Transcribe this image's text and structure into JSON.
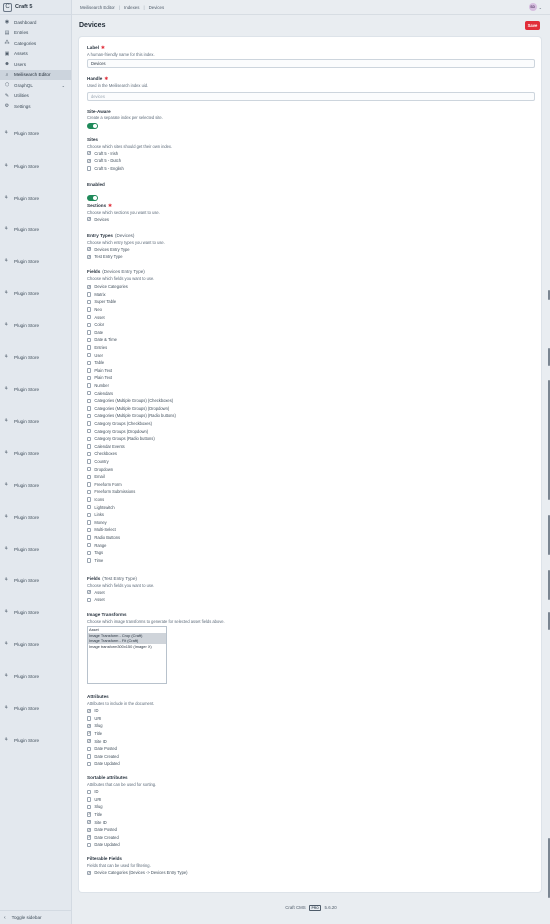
{
  "app": {
    "name": "Craft 5",
    "logo_letter": "C"
  },
  "nav": [
    {
      "label": "Dashboard",
      "icon": "gauge-icon",
      "glyph": "◉"
    },
    {
      "label": "Entries",
      "icon": "entries-icon",
      "glyph": "▤"
    },
    {
      "label": "Categories",
      "icon": "categories-icon",
      "glyph": "⁂"
    },
    {
      "label": "Assets",
      "icon": "image-icon",
      "glyph": "▣"
    },
    {
      "label": "Users",
      "icon": "users-icon",
      "glyph": "☻"
    },
    {
      "label": "Meilisearch Editor",
      "icon": "search-icon",
      "glyph": "⌕",
      "active": true
    },
    {
      "label": "GraphQL",
      "icon": "graphql-icon",
      "glyph": "⬡",
      "chevron": "⌄"
    },
    {
      "label": "Utilities",
      "icon": "wrench-icon",
      "glyph": "✎"
    },
    {
      "label": "Settings",
      "icon": "gear-icon",
      "glyph": "⚙"
    }
  ],
  "plugin_store_label": "Plugin Store",
  "toggle_sidebar_label": "Toggle sidebar",
  "breadcrumbs": [
    "Meilisearch Editor",
    "Indexes",
    "Devices"
  ],
  "user": {
    "initials": "SD",
    "chevron": "⌄"
  },
  "page": {
    "title": "Devices",
    "save_label": "Save"
  },
  "fields": {
    "label": {
      "label": "Label",
      "instructions": "A human-friendly name for this index.",
      "value": "Devices"
    },
    "handle": {
      "label": "Handle",
      "instructions": "Used in the Meilisearch index uid.",
      "value": "devices"
    },
    "site_aware": {
      "label": "Site-Aware",
      "instructions": "Create a separate index per selected site.",
      "on": true
    },
    "sites": {
      "label": "Sites",
      "instructions": "Choose which sites should get their own index.",
      "options": [
        {
          "label": "Craft 5 - Irish",
          "checked": true
        },
        {
          "label": "Craft 5 - Dutch",
          "checked": true
        },
        {
          "label": "Craft 5 - English",
          "checked": false
        }
      ]
    },
    "enabled": {
      "label": "Enabled",
      "on": true
    },
    "sections": {
      "label": "Sections",
      "instructions": "Choose which sections you want to use.",
      "options": [
        {
          "label": "Devices",
          "checked": true
        }
      ]
    },
    "entry_types": {
      "label": "Entry Types",
      "sub": "(Devices)",
      "instructions": "Choose which entry types you want to use.",
      "options": [
        {
          "label": "Devices Entry Type",
          "checked": true
        },
        {
          "label": "Test Entry Type",
          "checked": true
        }
      ]
    },
    "fields_devices": {
      "label": "Fields",
      "sub": "(Devices Entry Type)",
      "instructions": "Choose which fields you want to use.",
      "options": [
        {
          "label": "Device Categories",
          "checked": true
        },
        {
          "label": "Matrix",
          "checked": false
        },
        {
          "label": "Super Table",
          "checked": false
        },
        {
          "label": "Neo",
          "checked": false
        },
        {
          "label": "Asset",
          "checked": false
        },
        {
          "label": "Color",
          "checked": false
        },
        {
          "label": "Date",
          "checked": false
        },
        {
          "label": "Date & Time",
          "checked": false
        },
        {
          "label": "Entries",
          "checked": false
        },
        {
          "label": "User",
          "checked": false
        },
        {
          "label": "Table",
          "checked": false
        },
        {
          "label": "Plain Text",
          "checked": false
        },
        {
          "label": "Plain Text",
          "checked": false
        },
        {
          "label": "Number",
          "checked": false
        },
        {
          "label": "Calendars",
          "checked": false
        },
        {
          "label": "Categories (Multiple Groups) (Checkboxes)",
          "checked": false
        },
        {
          "label": "Categories (Multiple Groups) (Dropdown)",
          "checked": false
        },
        {
          "label": "Categories (Multiple Groups) (Radio buttons)",
          "checked": false
        },
        {
          "label": "Category Groups (Checkboxes)",
          "checked": false
        },
        {
          "label": "Category Groups (Dropdown)",
          "checked": false
        },
        {
          "label": "Category Groups (Radio buttons)",
          "checked": false
        },
        {
          "label": "Calendar Events",
          "checked": false
        },
        {
          "label": "Checkboxes",
          "checked": false
        },
        {
          "label": "Country",
          "checked": false
        },
        {
          "label": "Dropdown",
          "checked": false
        },
        {
          "label": "Email",
          "checked": false
        },
        {
          "label": "Freeform Form",
          "checked": false
        },
        {
          "label": "Freeform Submissions",
          "checked": false
        },
        {
          "label": "Icons",
          "checked": false
        },
        {
          "label": "Lightswitch",
          "checked": false
        },
        {
          "label": "Links",
          "checked": false
        },
        {
          "label": "Money",
          "checked": false
        },
        {
          "label": "Multi-Select",
          "checked": false
        },
        {
          "label": "Radio Buttons",
          "checked": false
        },
        {
          "label": "Range",
          "checked": false
        },
        {
          "label": "Tags",
          "checked": false
        },
        {
          "label": "Time",
          "checked": false
        }
      ]
    },
    "fields_test": {
      "label": "Fields",
      "sub": "(Test Entry Type)",
      "instructions": "Choose which fields you want to use.",
      "options": [
        {
          "label": "Asset",
          "checked": true
        },
        {
          "label": "Asset",
          "checked": false
        }
      ]
    },
    "image_transforms": {
      "label": "Image Transforms",
      "instructions": "Choose which image transforms to generate for selected asset fields above.",
      "options": [
        {
          "label": "Asset",
          "selected": false
        },
        {
          "label": "Image Transform - Crop (Craft)",
          "selected": true
        },
        {
          "label": "Image Transform - Fit (Craft)",
          "selected": true
        },
        {
          "label": "Image transform300x150 (Imager X)",
          "selected": false
        }
      ]
    },
    "attributes": {
      "label": "Attributes",
      "instructions": "Attributes to include in the document.",
      "options": [
        {
          "label": "ID",
          "checked": true
        },
        {
          "label": "URI",
          "checked": false
        },
        {
          "label": "Slug",
          "checked": true
        },
        {
          "label": "Title",
          "checked": true
        },
        {
          "label": "Site ID",
          "checked": true
        },
        {
          "label": "Date Posted",
          "checked": false
        },
        {
          "label": "Date Created",
          "checked": false
        },
        {
          "label": "Date Updated",
          "checked": false
        }
      ]
    },
    "sortable": {
      "label": "Sortable attributes",
      "instructions": "Attributes that can be used for sorting.",
      "options": [
        {
          "label": "ID",
          "checked": false
        },
        {
          "label": "URI",
          "checked": false
        },
        {
          "label": "Slug",
          "checked": false
        },
        {
          "label": "Title",
          "checked": true
        },
        {
          "label": "Site ID",
          "checked": true
        },
        {
          "label": "Date Posted",
          "checked": true
        },
        {
          "label": "Date Created",
          "checked": true
        },
        {
          "label": "Date Updated",
          "checked": false
        }
      ]
    },
    "filterable": {
      "label": "Filterable Fields",
      "instructions": "Fields that can be used for filtering.",
      "options": [
        {
          "label": "Device Categories (Devices -> Devices Entry Type)",
          "checked": true
        }
      ]
    }
  },
  "footer": {
    "product": "Craft CMS",
    "edition": "PRO",
    "version": "5.6.20"
  },
  "colors": {
    "accent": "#e12d39",
    "switch_on": "#1f8a5a"
  }
}
